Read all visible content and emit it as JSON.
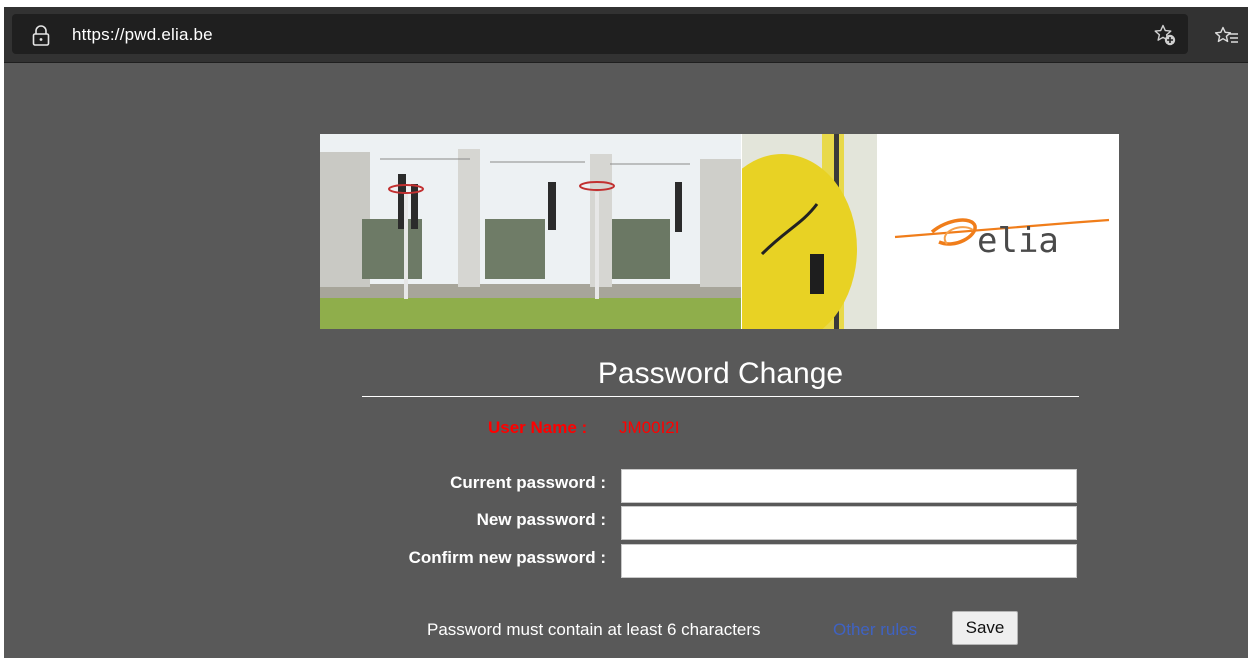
{
  "browser": {
    "url_protocol": "https://",
    "url_host": "pwd.elia.be",
    "icons": [
      "lock-icon",
      "add-favorite-icon",
      "favorites-list-icon"
    ]
  },
  "banner": {
    "logo_text": "elia",
    "brand_color": "#f07d1a"
  },
  "form": {
    "title": "Password Change",
    "user_label": "User Name :",
    "user_value": "JM00I2I",
    "fields": [
      {
        "label": "Current password :",
        "value": ""
      },
      {
        "label": "New password :",
        "value": ""
      },
      {
        "label": "Confirm new password :",
        "value": ""
      }
    ],
    "rules_text": "Password must contain at least 6 characters",
    "rules_link": "Other rules",
    "save_label": "Save"
  },
  "colors": {
    "background": "#595959",
    "error_red": "#ff0000",
    "link_blue": "#3f62c2"
  }
}
